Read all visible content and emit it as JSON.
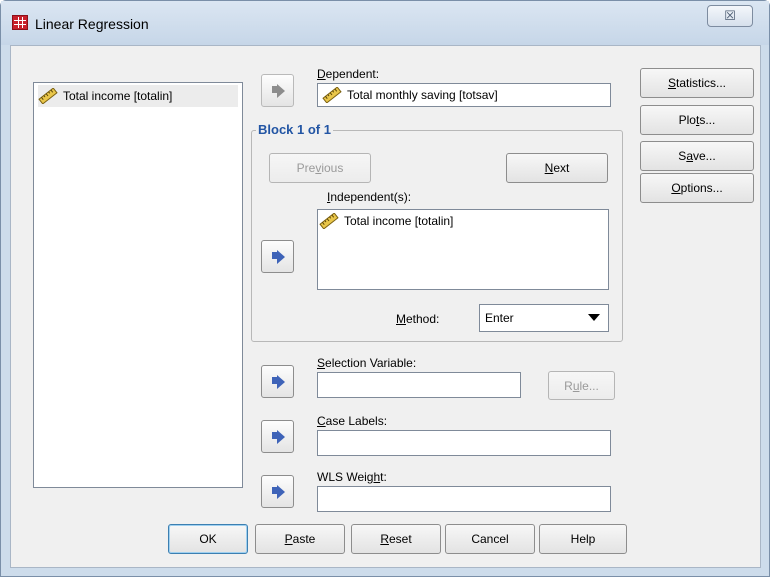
{
  "window": {
    "title": "Linear Regression",
    "close_glyph": "☒"
  },
  "source_list": {
    "items": [
      {
        "label": "Total income [totalin]",
        "icon": "scale-variable-icon"
      }
    ]
  },
  "dependent": {
    "label_u": "D",
    "label_rest": "ependent:",
    "value": "Total monthly saving [totsav]"
  },
  "block": {
    "title": "Block 1 of 1",
    "previous_pre": "Pre",
    "previous_u": "v",
    "previous_post": "ious",
    "next_u": "N",
    "next_post": "ext"
  },
  "independents": {
    "label_u": "I",
    "label_rest": "ndependent(s):",
    "items": [
      {
        "label": "Total income [totalin]",
        "icon": "scale-variable-icon"
      }
    ]
  },
  "method": {
    "label_u": "M",
    "label_rest": "ethod:",
    "selected": "Enter"
  },
  "selection_variable": {
    "label_u": "S",
    "label_rest": "election Variable:",
    "value": "",
    "rule_pre": "R",
    "rule_u": "u",
    "rule_post": "le..."
  },
  "case_labels": {
    "label_u": "C",
    "label_rest": "ase Labels:",
    "value": ""
  },
  "wls_weight": {
    "label_pre": "WLS Weig",
    "label_u": "h",
    "label_post": "t:",
    "value": ""
  },
  "side_buttons": {
    "statistics_u": "S",
    "statistics_post": "tatistics...",
    "plots_pre": "Plo",
    "plots_u": "t",
    "plots_post": "s...",
    "save_pre": "S",
    "save_u": "a",
    "save_post": "ve...",
    "options_u": "O",
    "options_post": "ptions..."
  },
  "bottom_buttons": {
    "ok": "OK",
    "paste_u": "P",
    "paste_post": "aste",
    "reset_u": "R",
    "reset_post": "eset",
    "cancel": "Cancel",
    "help": "Help"
  },
  "colors": {
    "arrow_active": "#3e63b8",
    "arrow_disabled": "#8c8c8c",
    "group_title": "#2255a4",
    "titlebar": "#dbe6f2"
  }
}
